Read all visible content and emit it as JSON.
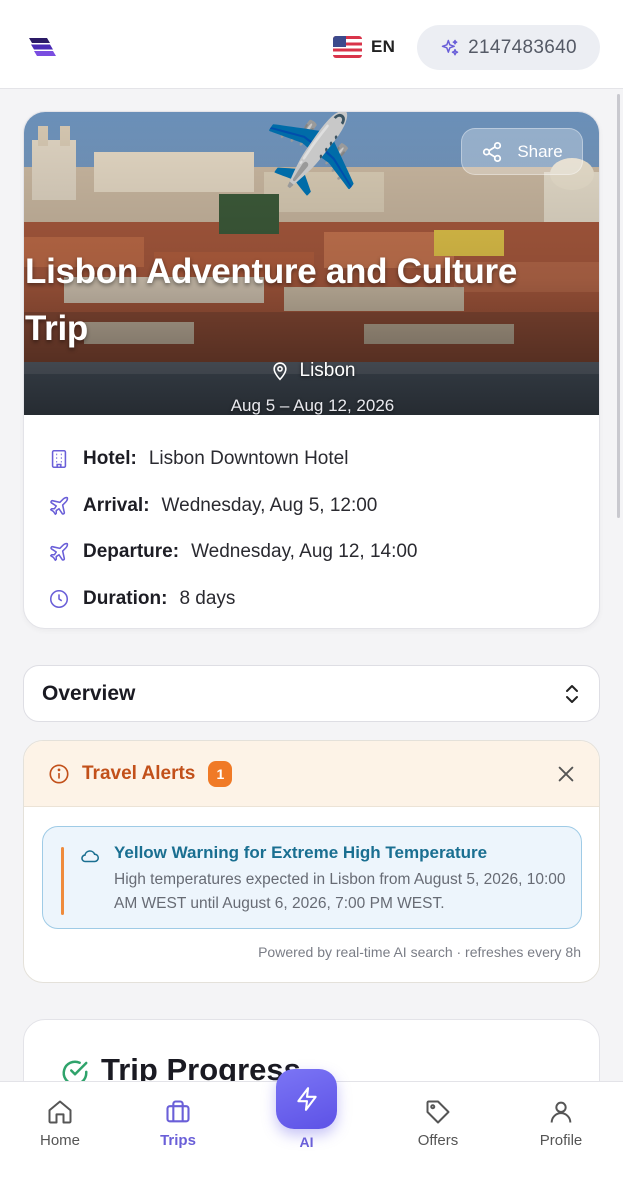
{
  "header": {
    "logo_icon": "brand-logo-icon",
    "language": "EN",
    "flag_icon": "us-flag-icon",
    "credits_icon": "sparkle-icon",
    "credits": "2147483640"
  },
  "trip": {
    "emoji": "✈️",
    "share_label": "Share",
    "title": "Lisbon Adventure and Culture Trip",
    "location": "Lisbon",
    "dates": "Aug 5 – Aug 12, 2026",
    "details": [
      {
        "icon": "building-icon",
        "label": "Hotel:",
        "value": "Lisbon Downtown Hotel"
      },
      {
        "icon": "plane-icon",
        "label": "Arrival:",
        "value": "Wednesday, Aug 5, 12:00"
      },
      {
        "icon": "plane-icon",
        "label": "Departure:",
        "value": "Wednesday, Aug 12, 14:00"
      },
      {
        "icon": "clock-icon",
        "label": "Duration:",
        "value": "8 days"
      }
    ]
  },
  "overview": {
    "label": "Overview"
  },
  "alerts": {
    "title": "Travel Alerts",
    "count": "1",
    "items": [
      {
        "title": "Yellow Warning for Extreme High Temperature",
        "text": "High temperatures expected in Lisbon from August 5, 2026, 10:00 AM WEST until August 6, 2026, 7:00 PM WEST."
      }
    ],
    "footer": "Powered by real-time AI search · refreshes every 8h"
  },
  "progress": {
    "title": "Trip Progress"
  },
  "nav": {
    "items": [
      {
        "label": "Home",
        "icon": "home-icon"
      },
      {
        "label": "Trips",
        "icon": "briefcase-icon"
      },
      {
        "label": "AI",
        "icon": "bolt-icon"
      },
      {
        "label": "Offers",
        "icon": "tag-icon"
      },
      {
        "label": "Profile",
        "icon": "user-icon"
      }
    ],
    "active": "Trips"
  },
  "colors": {
    "accent": "#6a5fd8",
    "alert_orange": "#c2501a",
    "alert_badge": "#f07a26",
    "alert_title_blue": "#1a6f91"
  }
}
